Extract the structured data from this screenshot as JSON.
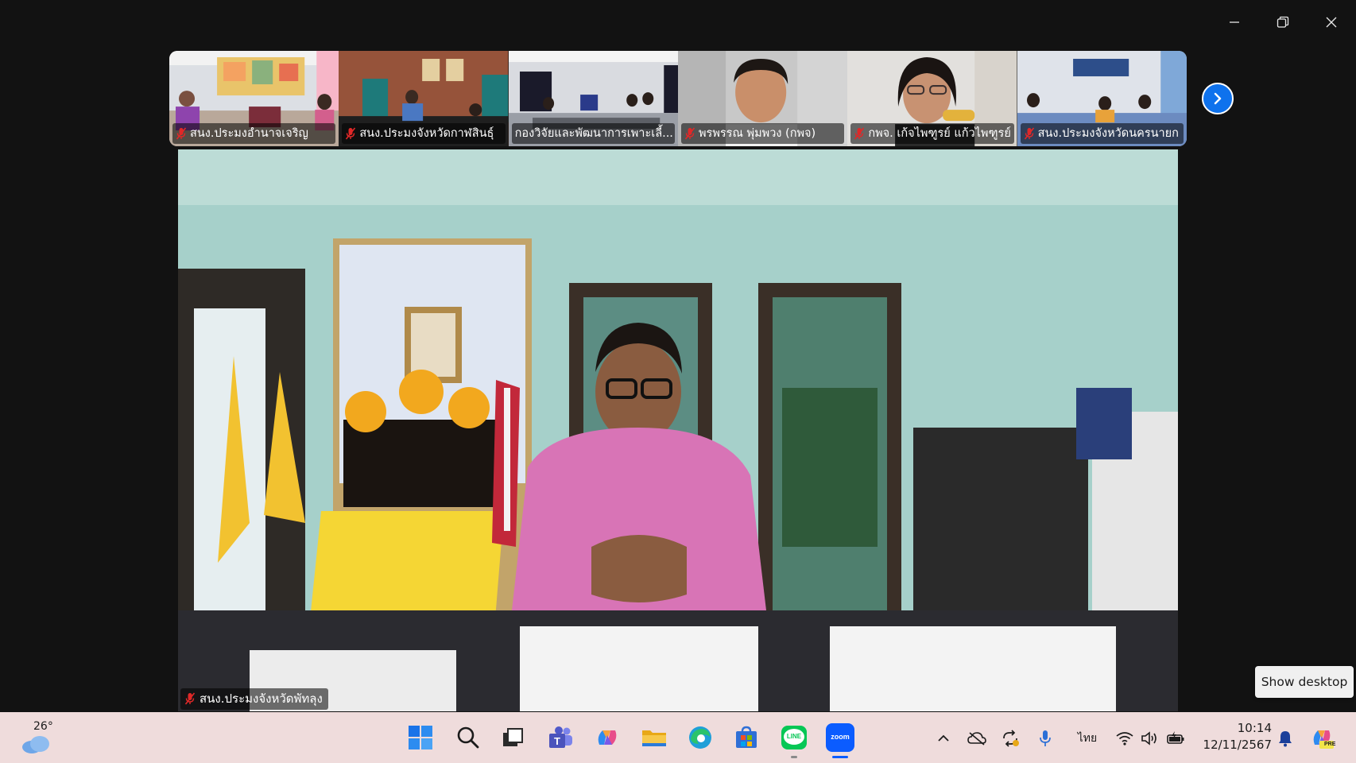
{
  "window": {
    "minimize_icon": "minimize-icon",
    "restore_icon": "restore-icon",
    "close_icon": "close-icon"
  },
  "participants": [
    {
      "name": "สนง.ประมงอำนาจเจริญ",
      "muted": true
    },
    {
      "name": "สนง.ประมงจังหวัดกาฬสินธุ์",
      "muted": true
    },
    {
      "name": "กองวิจัยและพัฒนาการเพาะเลี้...",
      "muted": false
    },
    {
      "name": "พรพรรณ พุ่มพวง (กพจ)",
      "muted": true
    },
    {
      "name": "กพจ. เก้จไพฑูรย์ แก้วไพฑูรย์",
      "muted": true
    },
    {
      "name": "สนง.ประมงจังหวัดนครนายก",
      "muted": true
    }
  ],
  "active_speaker": {
    "name": "สนง.ประมงจังหวัดพัทลุง",
    "muted": true
  },
  "show_desktop": "Show desktop",
  "taskbar": {
    "weather_temp": "26°",
    "apps": [
      "start-icon",
      "search-icon",
      "task-view-icon",
      "teams-icon",
      "copilot-icon",
      "file-explorer-icon",
      "edge-icon",
      "store-icon",
      "line-icon",
      "zoom-icon"
    ],
    "line_label": "LINE",
    "zoom_label": "zoom",
    "language": "ไทย",
    "time": "10:14",
    "date": "12/11/2567",
    "copilot_badge": "PRE"
  },
  "colors": {
    "zoom_blue": "#0e72ed",
    "taskbar_bg": "#efdcdc",
    "mute_red": "#e02828"
  }
}
